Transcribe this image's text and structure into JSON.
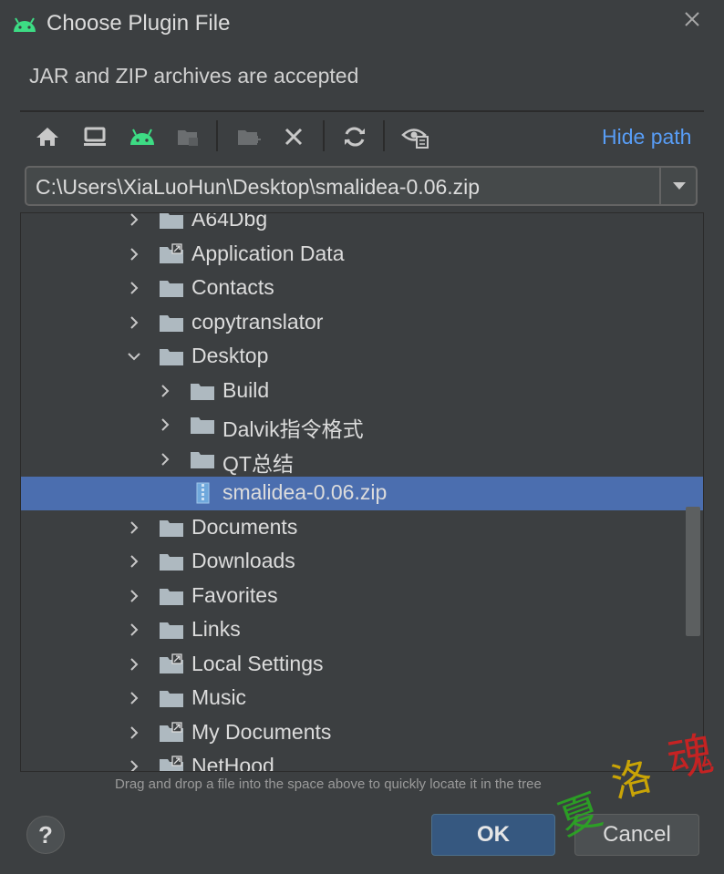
{
  "dialog": {
    "title": "Choose Plugin File",
    "subtitle": "JAR and ZIP archives are accepted",
    "hide_path_label": "Hide path"
  },
  "toolbar": {
    "buttons": [
      {
        "icon": "home-icon"
      },
      {
        "icon": "desktop-icon"
      },
      {
        "icon": "android-project-icon"
      },
      {
        "icon": "module-folder-icon"
      },
      {
        "icon": "new-folder-icon"
      },
      {
        "icon": "delete-icon"
      },
      {
        "icon": "refresh-icon"
      },
      {
        "icon": "show-hidden-files-icon"
      }
    ]
  },
  "path": {
    "value": "C:\\Users\\XiaLuoHun\\Desktop\\smalidea-0.06.zip"
  },
  "tree": {
    "items": [
      {
        "label": "A64Dbg",
        "level": 0,
        "type": "folder",
        "expanded": false
      },
      {
        "label": "Application Data",
        "level": 0,
        "type": "folder-link",
        "expanded": false
      },
      {
        "label": "Contacts",
        "level": 0,
        "type": "folder",
        "expanded": false
      },
      {
        "label": "copytranslator",
        "level": 0,
        "type": "folder",
        "expanded": false
      },
      {
        "label": "Desktop",
        "level": 0,
        "type": "folder",
        "expanded": true
      },
      {
        "label": "Build",
        "level": 1,
        "type": "folder",
        "expanded": false
      },
      {
        "label": "Dalvik指令格式",
        "level": 1,
        "type": "folder",
        "expanded": false
      },
      {
        "label": "QT总结",
        "level": 1,
        "type": "folder",
        "expanded": false
      },
      {
        "label": "smalidea-0.06.zip",
        "level": 1,
        "type": "zip",
        "selected": true
      },
      {
        "label": "Documents",
        "level": 0,
        "type": "folder",
        "expanded": false
      },
      {
        "label": "Downloads",
        "level": 0,
        "type": "folder",
        "expanded": false
      },
      {
        "label": "Favorites",
        "level": 0,
        "type": "folder",
        "expanded": false
      },
      {
        "label": "Links",
        "level": 0,
        "type": "folder",
        "expanded": false
      },
      {
        "label": "Local Settings",
        "level": 0,
        "type": "folder-link",
        "expanded": false
      },
      {
        "label": "Music",
        "level": 0,
        "type": "folder",
        "expanded": false
      },
      {
        "label": "My Documents",
        "level": 0,
        "type": "folder-link",
        "expanded": false
      },
      {
        "label": "NetHood",
        "level": 0,
        "type": "folder-link",
        "expanded": false
      }
    ]
  },
  "hint": "Drag and drop a file into the space above to quickly locate it in the tree",
  "footer": {
    "help_label": "?",
    "ok_label": "OK",
    "cancel_label": "Cancel"
  },
  "watermark": {
    "text": "夏洛魂"
  },
  "colors": {
    "background": "#3c3f41",
    "selection": "#4b6eaf",
    "link": "#589df6",
    "android_green": "#3ddc84",
    "ok_button": "#365880"
  }
}
